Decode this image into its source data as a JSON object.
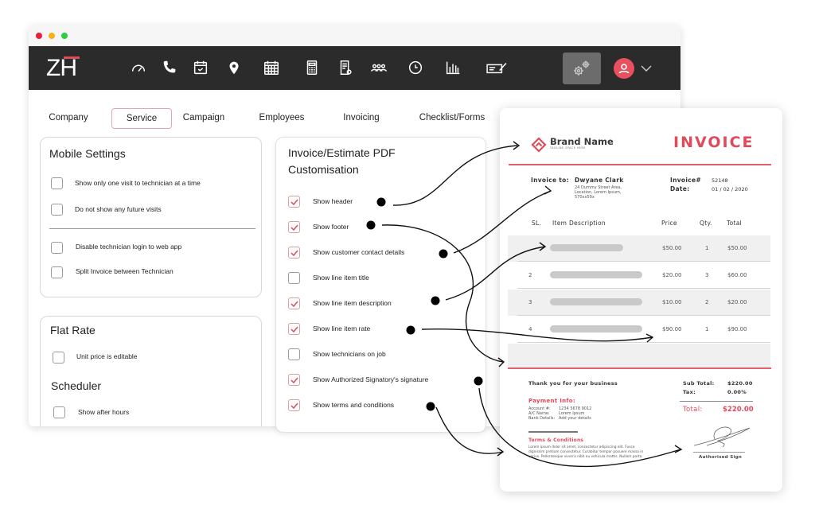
{
  "window": {
    "controls": [
      "close",
      "minimize",
      "maximize"
    ]
  },
  "navbar": {
    "logo": {
      "left": "Z",
      "right": "H"
    },
    "icons": [
      "dashboard-gauge-icon",
      "phone-icon",
      "calendar-check-icon",
      "location-pin-icon",
      "calendar-grid-icon",
      "calculator-icon",
      "invoice-document-icon",
      "team-icon",
      "clock-icon",
      "bar-chart-icon",
      "signature-icon"
    ],
    "settings_icon": "gears-icon",
    "user_icon": "user-avatar-icon",
    "dropdown_icon": "chevron-down-icon"
  },
  "tabs": [
    {
      "label": "Company",
      "active": false
    },
    {
      "label": "Service",
      "active": true
    },
    {
      "label": "Campaign",
      "active": false
    },
    {
      "label": "Employees",
      "active": false
    },
    {
      "label": "Invoicing",
      "active": false
    },
    {
      "label": "Checklist/Forms",
      "active": false
    }
  ],
  "mobile_settings": {
    "title": "Mobile Settings",
    "options": [
      {
        "label": "Show only one visit to technician at a time",
        "checked": false
      },
      {
        "label": "Do not show any future visits",
        "checked": false
      },
      {
        "label": "Disable technician login to web app",
        "checked": false
      },
      {
        "label": "Split Invoice between Technician",
        "checked": false
      }
    ]
  },
  "flat_rate": {
    "title": "Flat Rate",
    "options": [
      {
        "label": "Unit price is editable",
        "checked": false
      }
    ]
  },
  "scheduler": {
    "title": "Scheduler",
    "options": [
      {
        "label": "Show after hours",
        "checked": false
      }
    ]
  },
  "pdf_customisation": {
    "title_line1": "Invoice/Estimate PDF",
    "title_line2": "Customisation",
    "options": [
      {
        "label": "Show header",
        "checked": true
      },
      {
        "label": "Show footer",
        "checked": true
      },
      {
        "label": "Show customer contact details",
        "checked": true
      },
      {
        "label": "Show line item title",
        "checked": false
      },
      {
        "label": "Show line item description",
        "checked": true
      },
      {
        "label": "Show line item rate",
        "checked": true
      },
      {
        "label": "Show technicians on job",
        "checked": false
      },
      {
        "label": "Show Authorized Signatory's signature",
        "checked": true
      },
      {
        "label": "Show terms and conditions",
        "checked": true
      }
    ]
  },
  "invoice": {
    "brand_name": "Brand Name",
    "tagline": "TAGLINE SPACE HERE",
    "title": "INVOICE",
    "invoice_to_label": "Invoice to:",
    "customer_name": "Dwyane Clark",
    "customer_address": [
      "24 Dummy Street Area,",
      "Location, Lorem Ipsum,",
      "570xx59x"
    ],
    "invoice_no_label": "Invoice#",
    "invoice_no": "52148",
    "date_label": "Date:",
    "date": "01 / 02 / 2020",
    "columns": [
      "SL.",
      "Item Description",
      "Price",
      "Qty.",
      "Total"
    ],
    "rows": [
      {
        "sl": "",
        "price": "$50.00",
        "qty": "1",
        "total": "$50.00"
      },
      {
        "sl": "2",
        "price": "$20.00",
        "qty": "3",
        "total": "$60.00"
      },
      {
        "sl": "3",
        "price": "$10.00",
        "qty": "2",
        "total": "$20.00"
      },
      {
        "sl": "4",
        "price": "$90.00",
        "qty": "1",
        "total": "$90.00"
      }
    ],
    "thank_you": "Thank you for your business",
    "payment_info_title": "Payment Info:",
    "payment_info": [
      {
        "label": "Account #:",
        "value": "1234 5678 9012"
      },
      {
        "label": "A/C Name:",
        "value": "Lorem Ipsum"
      },
      {
        "label": "Bank Details:",
        "value": "Add your details"
      }
    ],
    "sub_total_label": "Sub Total:",
    "sub_total": "$220.00",
    "tax_label": "Tax:",
    "tax": "0.00%",
    "total_label": "Total:",
    "total": "$220.00",
    "terms_title": "Terms & Conditions",
    "terms_text": [
      "Lorem ipsum dolor sit amet, consectetur adipiscing elit. Fusce",
      "dignissim pretium consectetur. Curabitur tempor posuere massa in",
      "varius. Pellentesque viverra nibh eu vehicula mattis. Nullam porta"
    ],
    "signature_label": "Authorised Sign"
  },
  "colors": {
    "accent": "#e04a5a",
    "navbar": "#2b2b2b",
    "settings_button": "#6c6c6c"
  }
}
